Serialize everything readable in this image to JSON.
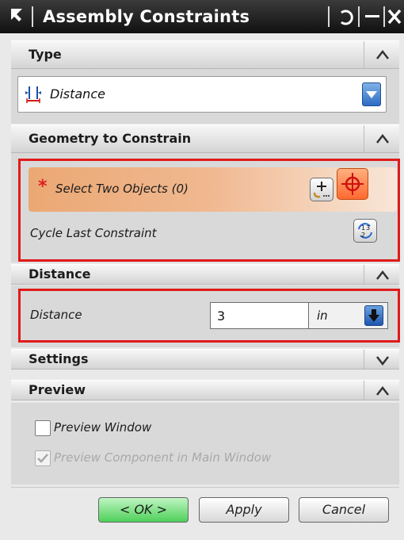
{
  "window": {
    "title": "Assembly Constraints"
  },
  "sections": {
    "type": {
      "label": "Type"
    },
    "geometry": {
      "label": "Geometry to Constrain"
    },
    "distance": {
      "label": "Distance"
    },
    "settings": {
      "label": "Settings"
    },
    "preview": {
      "label": "Preview"
    }
  },
  "type_dropdown": {
    "value": "Distance"
  },
  "geometry": {
    "select_label": "Select Two Objects (0)",
    "required_marker": "*",
    "cycle_label": "Cycle Last Constraint"
  },
  "distance": {
    "label": "Distance",
    "value": "3",
    "unit": "in"
  },
  "preview": {
    "preview_window_label": "Preview Window",
    "preview_component_label": "Preview Component in Main Window",
    "preview_window_checked": false,
    "preview_component_checked": true
  },
  "buttons": {
    "ok": "< OK >",
    "apply": "Apply",
    "cancel": "Cancel"
  },
  "colors": {
    "highlight_red": "#e01a1a",
    "selection_orange": "#eba874",
    "ok_green": "#4fd05a",
    "dropdown_blue": "#2d6cc4"
  }
}
